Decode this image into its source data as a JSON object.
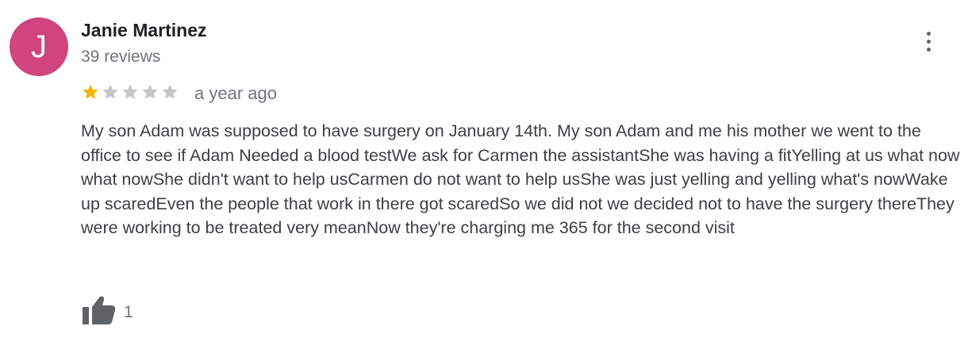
{
  "review": {
    "author": {
      "initial": "J",
      "name": "Janie Martinez",
      "review_count": "39 reviews",
      "avatar_color": "#d1457e"
    },
    "rating": {
      "value": 1,
      "max": 5,
      "filled_color": "#f4b400",
      "empty_color": "#c6c6c6"
    },
    "time": "a year ago",
    "text": "My son Adam was supposed to have surgery on January 14th. My son Adam and me his mother we went to the office to see if Adam Needed a blood testWe ask for Carmen the assistantShe was having a fitYelling at us what now what nowShe didn't want to help usCarmen do not want to help usShe was just yelling and yelling what's nowWake up scaredEven the people that work in there got scaredSo we did not we decided not to have the surgery thereThey were working to be treated very meanNow they're charging me 365 for the second visit",
    "likes": "1",
    "icons": {
      "menu": "more-vert-icon",
      "like": "thumbs-up-icon",
      "star": "star-icon"
    }
  }
}
